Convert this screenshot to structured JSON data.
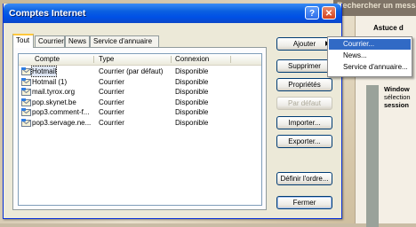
{
  "background": {
    "header_text": "Rechercher un messa",
    "panel_title": "Astuce d",
    "panel_lines": [
      "Window",
      "sélection",
      "session"
    ]
  },
  "dialog": {
    "title": "Comptes Internet",
    "tabs": [
      "Tout",
      "Courrier",
      "News",
      "Service d'annuaire"
    ],
    "columns": [
      "Compte",
      "Type",
      "Connexion"
    ],
    "accounts": [
      {
        "name": "Hotmail",
        "type": "Courrier (par défaut)",
        "connection": "Disponible"
      },
      {
        "name": "Hotmail (1)",
        "type": "Courrier",
        "connection": "Disponible"
      },
      {
        "name": "mail.tyrox.org",
        "type": "Courrier",
        "connection": "Disponible"
      },
      {
        "name": "pop.skynet.be",
        "type": "Courrier",
        "connection": "Disponible"
      },
      {
        "name": "pop3.comment-f...",
        "type": "Courrier",
        "connection": "Disponible"
      },
      {
        "name": "pop3.servage.ne...",
        "type": "Courrier",
        "connection": "Disponible"
      }
    ],
    "buttons": {
      "add": "Ajouter",
      "remove": "Supprimer",
      "properties": "Propriétés",
      "set_default": "Par défaut",
      "import": "Importer...",
      "export": "Exporter...",
      "set_order": "Définir l'ordre...",
      "close": "Fermer"
    }
  },
  "add_menu": {
    "items": [
      "Courrier...",
      "News...",
      "Service d'annuaire..."
    ]
  },
  "colors": {
    "titlebar": "#0050e6",
    "selection": "#316ac5"
  }
}
